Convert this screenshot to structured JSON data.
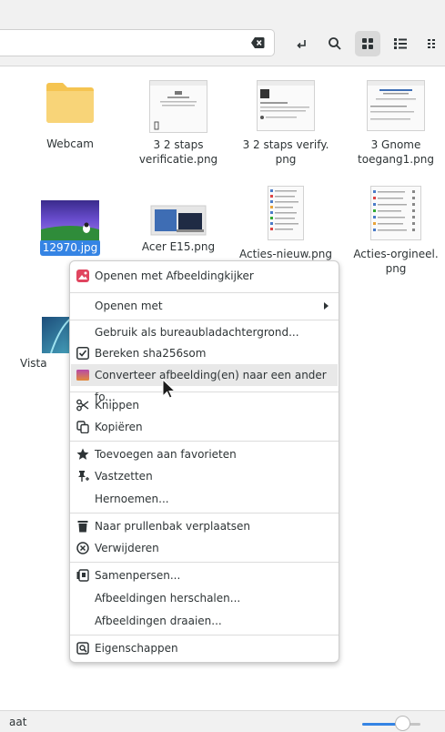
{
  "headerbar": {
    "path_text": "",
    "view_grid_active": true
  },
  "files": [
    {
      "name": "Webcam",
      "type": "folder"
    },
    {
      "name": "3 2 staps verificatie.png",
      "type": "image"
    },
    {
      "name": "3 2 staps verify. png",
      "type": "image"
    },
    {
      "name": "3 Gnome toegang1.png",
      "type": "image"
    },
    {
      "name": "12970.jpg",
      "type": "image",
      "selected": true
    },
    {
      "name": "Acer E15.png",
      "type": "image"
    },
    {
      "name": "Acties-nieuw.png",
      "type": "image"
    },
    {
      "name": "Acties-orgineel. png",
      "type": "image"
    },
    {
      "name": "Vista",
      "type": "image"
    }
  ],
  "context_menu": {
    "items": [
      {
        "label": "Openen met Afbeeldingkijker",
        "icon": "image-viewer-icon"
      },
      {
        "label": "Openen met",
        "submenu": true
      },
      {
        "label": "Gebruik als bureaubladachtergrond..."
      },
      {
        "label": "Bereken sha256som",
        "icon": "checkbox-icon"
      },
      {
        "label": "Converteer afbeelding(en) naar een ander fo...",
        "icon": "convert-image-icon",
        "highlighted": true
      },
      {
        "label": "Knippen",
        "icon": "scissors-icon"
      },
      {
        "label": "Kopiëren",
        "icon": "copy-icon"
      },
      {
        "label": "Toevoegen aan favorieten",
        "icon": "star-icon"
      },
      {
        "label": "Vastzetten",
        "icon": "pin-icon"
      },
      {
        "label": "Hernoemen..."
      },
      {
        "label": "Naar prullenbak verplaatsen",
        "icon": "trash-icon"
      },
      {
        "label": "Verwijderen",
        "icon": "delete-icon"
      },
      {
        "label": "Samenpersen...",
        "icon": "compress-icon"
      },
      {
        "label": "Afbeeldingen herschalen..."
      },
      {
        "label": "Afbeeldingen draaien..."
      },
      {
        "label": "Eigenschappen",
        "icon": "properties-icon"
      }
    ]
  },
  "statusbar": {
    "text": "aat",
    "zoom_level": 0.68
  },
  "colors": {
    "accent": "#3584e4",
    "folder": "#f5c451"
  }
}
